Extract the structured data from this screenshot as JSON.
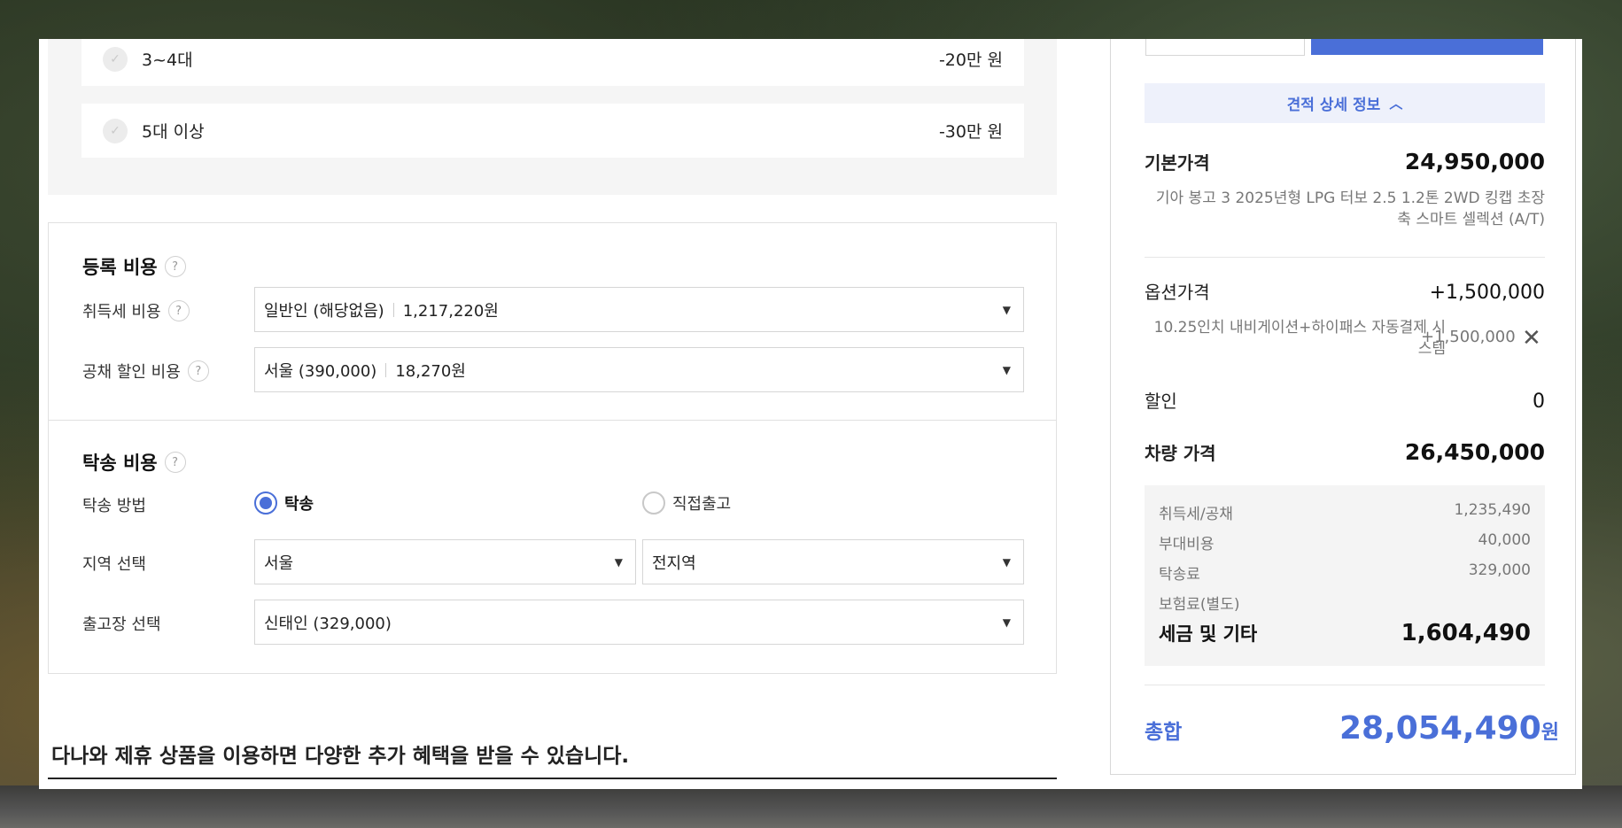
{
  "discounts": [
    {
      "label": "3~4대",
      "amount": "-20만 원"
    },
    {
      "label": "5대 이상",
      "amount": "-30만 원"
    }
  ],
  "registration": {
    "title": "등록 비용",
    "acquisition_tax": {
      "label": "취득세 비용",
      "value": "일반인 (해당없음)",
      "amount": "1,217,220원"
    },
    "bond_discount": {
      "label": "공채 할인 비용",
      "value": "서울 (390,000)",
      "amount": "18,270원"
    }
  },
  "delivery": {
    "title": "탁송 비용",
    "method_label": "탁송 방법",
    "options": [
      "탁송",
      "직접출고"
    ],
    "selected": "탁송",
    "region_label": "지역 선택",
    "region": "서울",
    "subregion": "전지역",
    "depot_label": "출고장 선택",
    "depot": "신태인 (329,000)"
  },
  "promo_text": "다나와 제휴 상품을 이용하면 다양한 추가 혜택을 받을 수 있습니다.",
  "summary": {
    "details_toggle": "견적 상세 정보",
    "base_price_label": "기본가격",
    "base_price": "24,950,000",
    "base_desc": "기아 봉고 3 2025년형 LPG 터보 2.5 1.2톤 2WD 킹캡 초장축 스마트 셀렉션 (A/T)",
    "option_price_label": "옵션가격",
    "option_price": "+1,500,000",
    "option_item": "10.25인치 내비게이션+하이패스 자동결제 시스템",
    "option_item_price": "+1,500,000",
    "discount_label": "할인",
    "discount": "0",
    "vehicle_price_label": "차량 가격",
    "vehicle_price": "26,450,000",
    "taxes": [
      {
        "label": "취득세/공채",
        "value": "1,235,490"
      },
      {
        "label": "부대비용",
        "value": "40,000"
      },
      {
        "label": "탁송료",
        "value": "329,000"
      },
      {
        "label": "보험료(별도)",
        "value": ""
      }
    ],
    "tax_total_label": "세금 및 기타",
    "tax_total": "1,604,490",
    "grand_total_label": "총합",
    "grand_total": "28,054,490",
    "grand_total_unit": "원"
  },
  "colors": {
    "accent": "#4a6fd8"
  },
  "icons": {
    "help": "question-circle-icon",
    "check": "check-circle-icon",
    "dropdown": "caret-down-icon",
    "close": "close-icon",
    "chevron": "chevron-up-icon"
  }
}
